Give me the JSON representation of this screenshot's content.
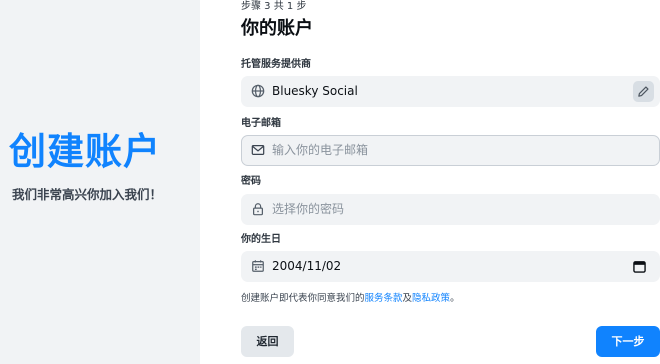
{
  "hero": {
    "title": "创建账户",
    "subtitle": "我们非常高兴你加入我们！"
  },
  "form": {
    "step": "步骤 3 共 1 步",
    "title": "你的账户",
    "hosting": {
      "label": "托管服务提供商",
      "value": "Bluesky Social",
      "icon": "globe-icon",
      "edit_icon": "pencil-icon"
    },
    "email": {
      "label": "电子邮箱",
      "placeholder": "输入你的电子邮箱",
      "icon": "envelope-icon"
    },
    "password": {
      "label": "密码",
      "placeholder": "选择你的密码",
      "icon": "lock-icon"
    },
    "birthday": {
      "label": "你的生日",
      "value": "2004/11/02",
      "icon": "calendar-icon"
    },
    "legal": {
      "prefix": "创建账户即代表你同意我们的",
      "terms": "服务条款",
      "conjunction": "及",
      "privacy": "隐私政策",
      "suffix": "。"
    },
    "buttons": {
      "back": "返回",
      "next": "下一步"
    }
  },
  "colors": {
    "accent": "#1083fe",
    "panel": "#f1f3f5",
    "field": "#f1f3f5"
  }
}
